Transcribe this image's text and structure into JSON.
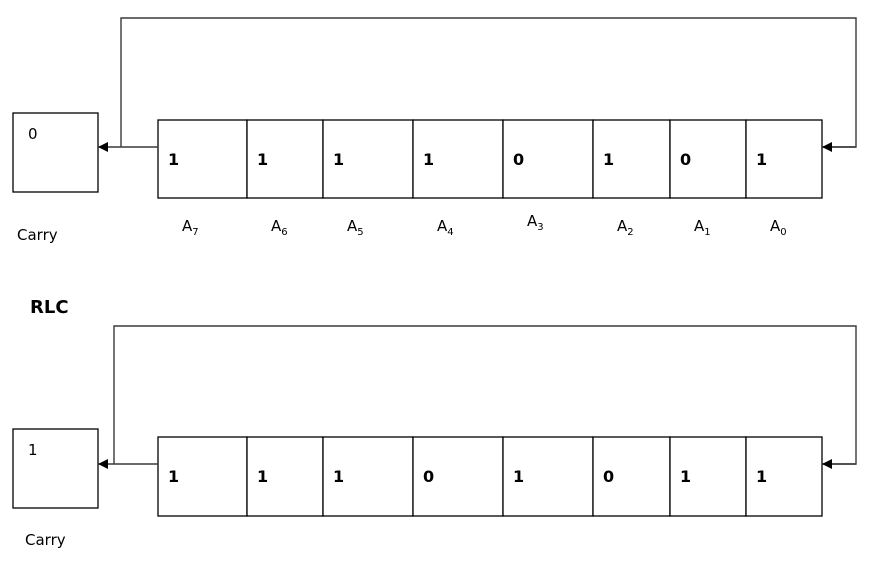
{
  "diagram": {
    "title": "RLC",
    "before": {
      "carry": {
        "value": "0",
        "label": "Carry"
      },
      "bits": [
        {
          "label": "A",
          "index": "7",
          "value": "1"
        },
        {
          "label": "A",
          "index": "6",
          "value": "1"
        },
        {
          "label": "A",
          "index": "5",
          "value": "1"
        },
        {
          "label": "A",
          "index": "4",
          "value": "1"
        },
        {
          "label": "A",
          "index": "3",
          "value": "0"
        },
        {
          "label": "A",
          "index": "2",
          "value": "1"
        },
        {
          "label": "A",
          "index": "1",
          "value": "0"
        },
        {
          "label": "A",
          "index": "0",
          "value": "1"
        }
      ]
    },
    "after": {
      "carry": {
        "value": "1",
        "label": "Carry"
      },
      "bits": [
        {
          "value": "1"
        },
        {
          "value": "1"
        },
        {
          "value": "1"
        },
        {
          "value": "0"
        },
        {
          "value": "1"
        },
        {
          "value": "0"
        },
        {
          "value": "1"
        },
        {
          "value": "1"
        }
      ]
    }
  }
}
